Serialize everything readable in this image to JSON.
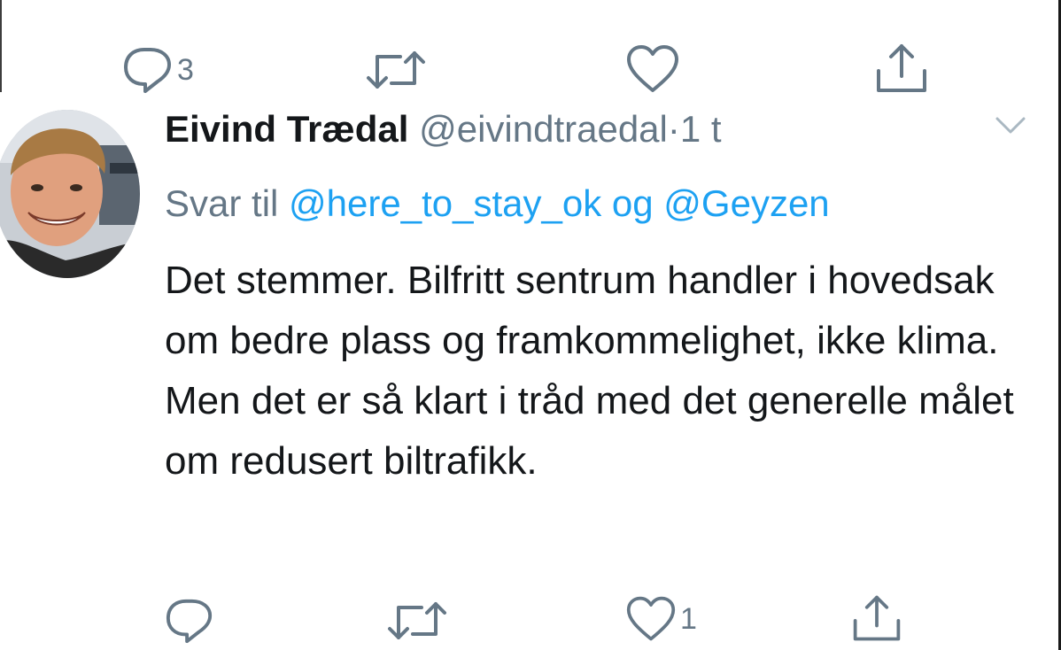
{
  "prev_tweet": {
    "reply_count": "3",
    "retweet_count": "",
    "like_count": "",
    "icons": [
      "reply-icon",
      "retweet-icon",
      "like-icon",
      "share-icon"
    ]
  },
  "tweet": {
    "author_name": "Eivind Trædal",
    "author_handle": "@eivindtraedal",
    "separator": "·",
    "time": "1 t",
    "reply_prefix": "Svar til",
    "mention_1": "@here_to_stay_ok",
    "reply_joiner": "og",
    "mention_2": "@Geyzen",
    "text": "Det stemmer. Bilfritt sentrum handler i hovedsak om bedre plass og framkommelighet, ikke klima. Men det er så klart i tråd med det generelle målet om redusert biltrafikk.",
    "reply_count": "",
    "retweet_count": "",
    "like_count": "1"
  },
  "colors": {
    "text_primary": "#14171a",
    "text_secondary": "#657786",
    "link": "#1da1f2",
    "background": "#ffffff"
  }
}
